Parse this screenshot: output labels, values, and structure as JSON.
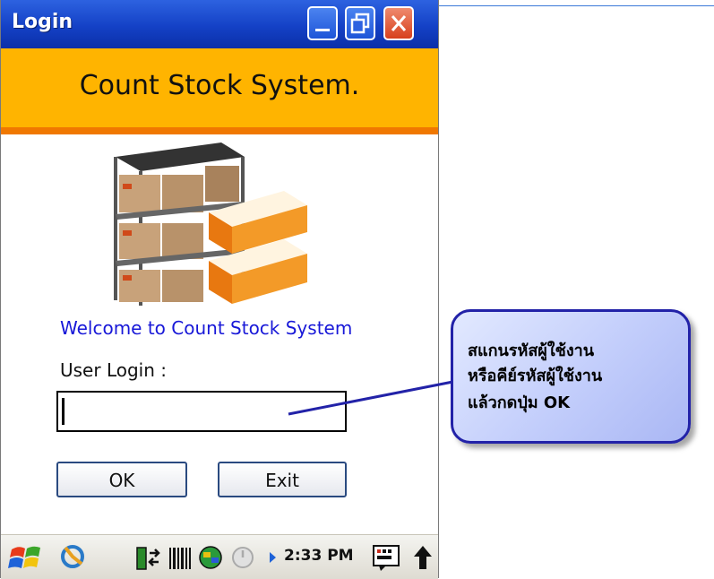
{
  "window": {
    "title": "Login",
    "buttons": [
      "minimize",
      "maximize",
      "close"
    ]
  },
  "banner": {
    "title": "Count Stock System."
  },
  "form": {
    "welcome": "Welcome to Count Stock System",
    "user_label": "User Login :",
    "user_value": "",
    "ok_label": "OK",
    "exit_label": "Exit"
  },
  "taskbar": {
    "time": "2:33 PM",
    "icons": [
      "start-icon",
      "sync-icon",
      "battery-icon",
      "barcode-icon",
      "network-icon",
      "power-icon",
      "arrow-right-icon",
      "keyboard-icon",
      "up-arrow-icon"
    ]
  },
  "callout": {
    "lines": [
      "สแกนรหัสผู้ใช้งาน",
      "หรือคีย์รหัสผู้ใช้งาน",
      "แล้วกดปุ่ม OK"
    ]
  },
  "colors": {
    "titlebar": "#1441c6",
    "banner": "#ffb400",
    "banner_border": "#f07800",
    "welcome_text": "#1818d8",
    "callout_border": "#2222a8"
  }
}
